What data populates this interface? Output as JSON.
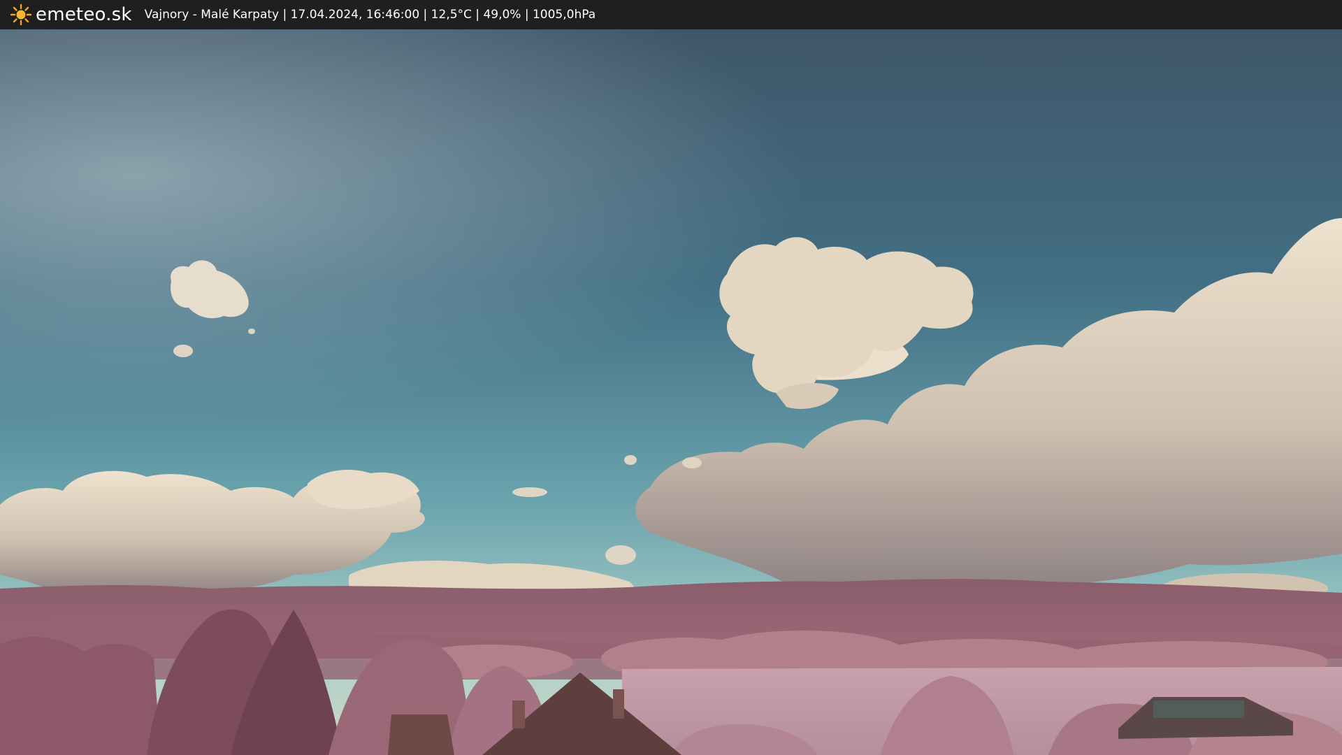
{
  "header": {
    "brand": "emeteo.sk",
    "logo_icon": "sun-icon",
    "caption": "Vajnory - Malé Karpaty | 17.04.2024, 16:46:00 | 12,5°C | 49,0% | 1005,0hPa",
    "background": "#1f1f1f",
    "sun_color": "#f5a623"
  },
  "scene": {
    "sky_top": "#3e5a6e",
    "sky_bottom": "#9fc8c6",
    "cloud_color": "#e8dcc8",
    "foliage_color": "#a86878"
  }
}
